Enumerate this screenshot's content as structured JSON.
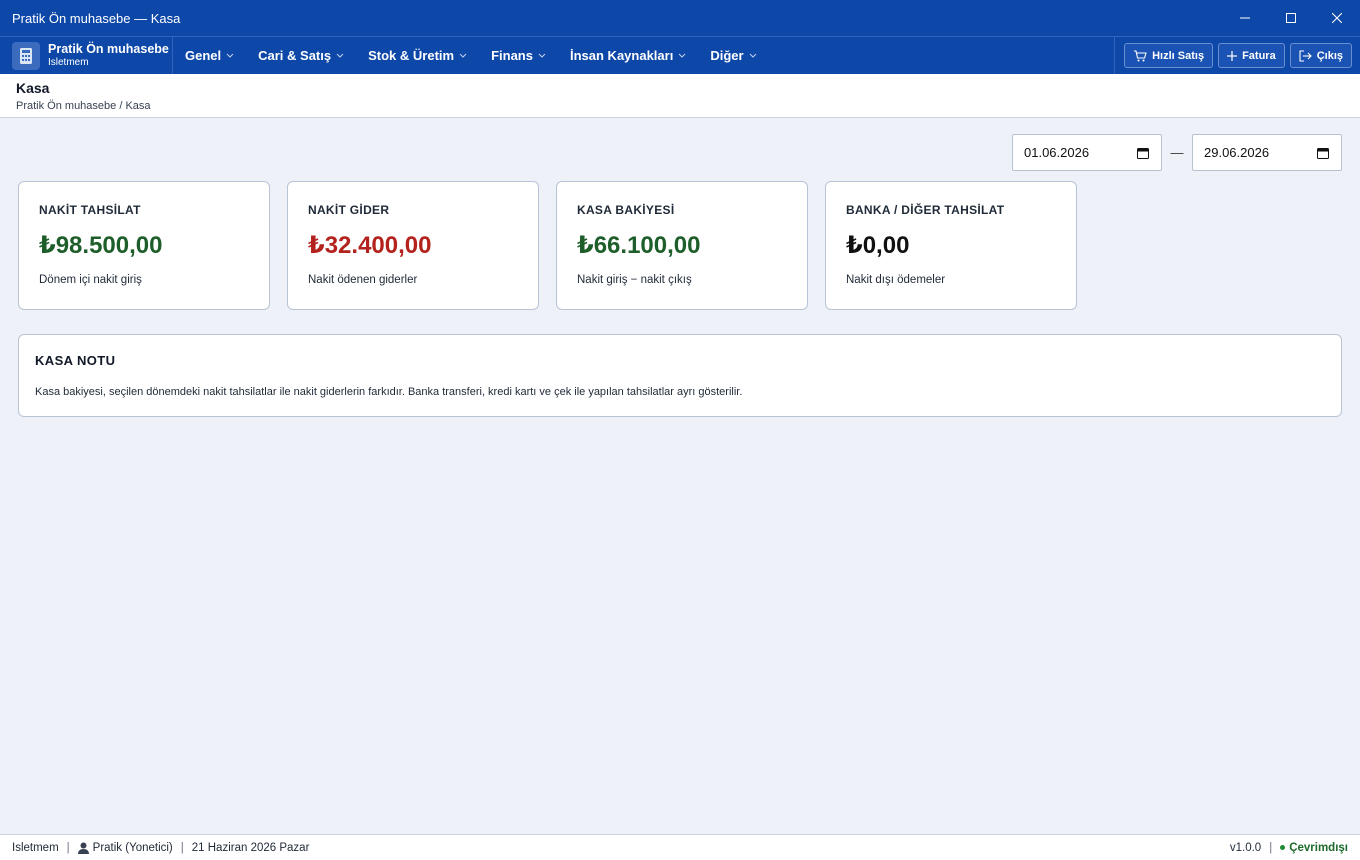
{
  "window": {
    "title": "Pratik Ön muhasebe — Kasa"
  },
  "brand": {
    "name": "Pratik Ön muhasebe",
    "subtitle": "Isletmem"
  },
  "menu": [
    {
      "label": "Genel"
    },
    {
      "label": "Cari & Satış"
    },
    {
      "label": "Stok & Üretim"
    },
    {
      "label": "Finans"
    },
    {
      "label": "İnsan Kaynakları"
    },
    {
      "label": "Diğer"
    }
  ],
  "actions": {
    "quick_sale": "Hızlı Satış",
    "invoice": "Fatura",
    "logout": "Çıkış"
  },
  "header": {
    "title": "Kasa",
    "breadcrumb": "Pratik Ön muhasebe / Kasa"
  },
  "date_range": {
    "start": "01.06.2026",
    "separator": "—",
    "end": "29.06.2026"
  },
  "cards": [
    {
      "label": "NAKİT TAHSİLAT",
      "value": "₺98.500,00",
      "description": "Dönem içi nakit giriş",
      "color": "#1e5e2a"
    },
    {
      "label": "NAKİT GİDER",
      "value": "₺32.400,00",
      "description": "Nakit ödenen giderler",
      "color": "#b3221c"
    },
    {
      "label": "KASA BAKİYESİ",
      "value": "₺66.100,00",
      "description": "Nakit giriş − nakit çıkış",
      "color": "#1e5e2a"
    },
    {
      "label": "BANKA / DİĞER TAHSİLAT",
      "value": "₺0,00",
      "description": "Nakit dışı ödemeler",
      "color": "#111111"
    }
  ],
  "note": {
    "title": "KASA NOTU",
    "text": "Kasa bakiyesi, seçilen dönemdeki nakit tahsilatlar ile nakit giderlerin farkıdır. Banka transferi, kredi kartı ve çek ile yapılan tahsilatlar ayrı gösterilir."
  },
  "status": {
    "company": "Isletmem",
    "user": "Pratik (Yonetici)",
    "date": "21 Haziran 2026 Pazar",
    "version": "v1.0.0",
    "connection": "Çevrimdışı"
  },
  "colors": {
    "primary": "#0d47a8",
    "positive": "#1e5e2a",
    "negative": "#b3221c"
  }
}
